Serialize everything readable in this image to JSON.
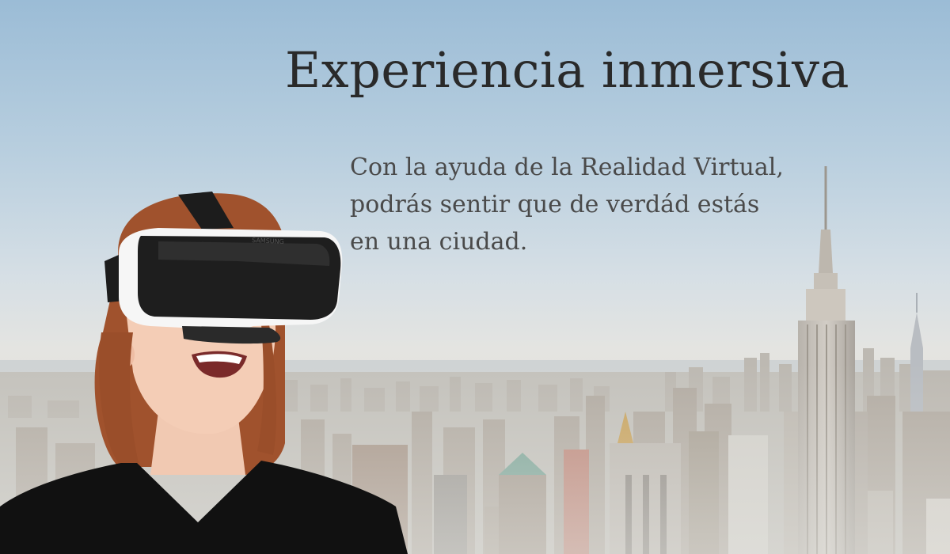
{
  "headline": "Experiencia inmersiva",
  "subtext_lines": [
    "Con la ayuda de la Realidad Virtual,",
    "podrás sentir que de verdád estás",
    "en una ciudad."
  ],
  "headset_brand": "SAMSUNG",
  "colors": {
    "sky_top": "#9bbcd6",
    "haze": "#e4e4e1",
    "headline_text": "#2a2a2a",
    "body_text": "#4a4a4a",
    "hair": "#a0522d",
    "headset_shell": "#ffffff",
    "headset_visor": "#1e1e1e",
    "shirt": "#111111"
  }
}
